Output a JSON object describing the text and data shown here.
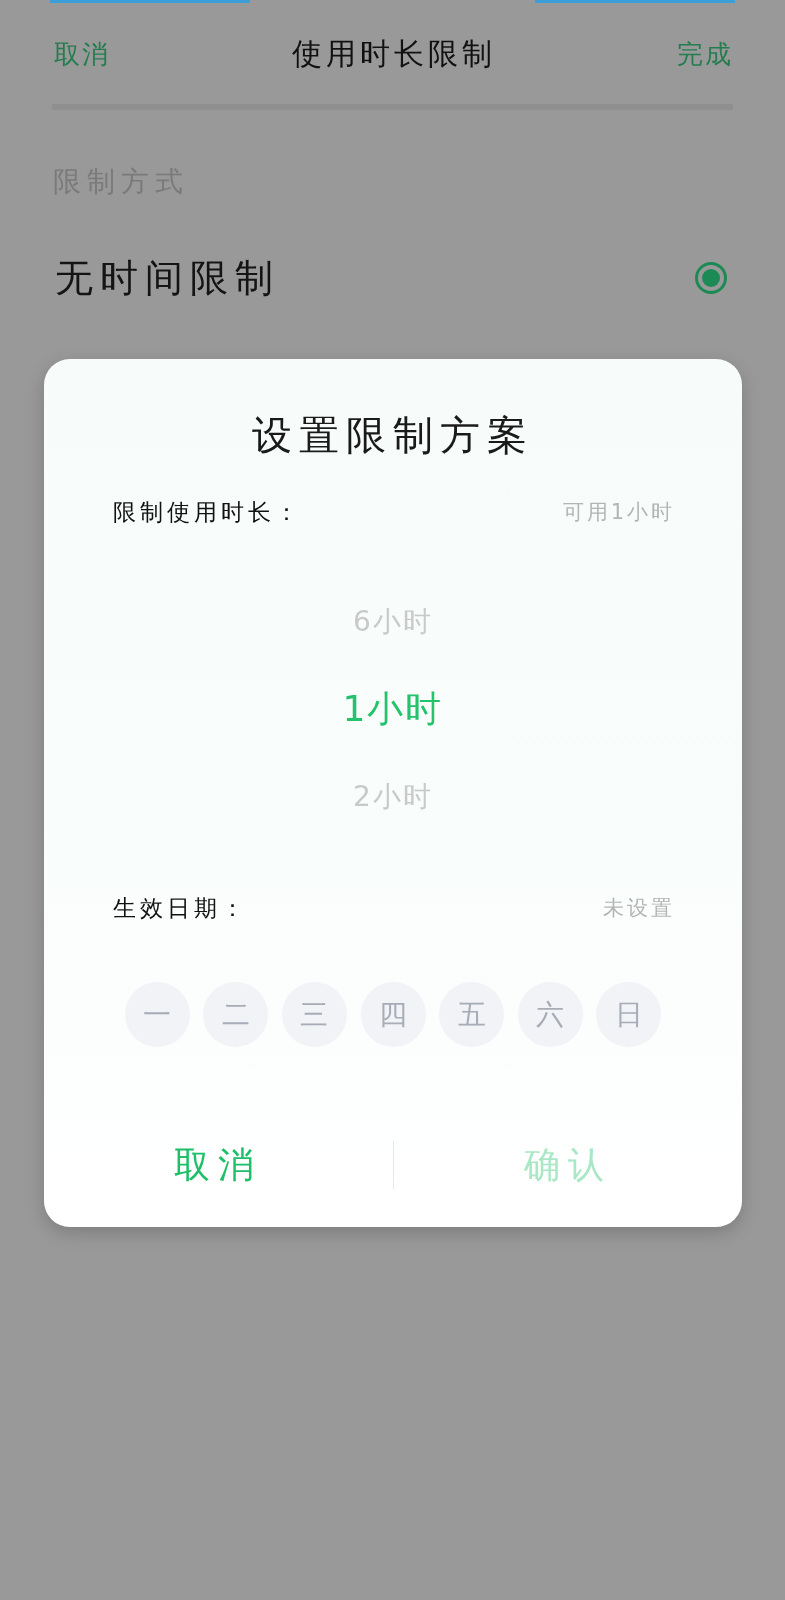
{
  "header": {
    "cancel": "取消",
    "title": "使用时长限制",
    "done": "完成"
  },
  "section_label": "限制方式",
  "options": [
    {
      "label": "无时间限制",
      "selected": true
    }
  ],
  "dialog": {
    "title": "设置限制方案",
    "duration": {
      "label": "限制使用时长：",
      "value": "可用1小时",
      "picker": [
        {
          "label": "6小时",
          "selected": false
        },
        {
          "label": "1小时",
          "selected": true
        },
        {
          "label": "2小时",
          "selected": false
        }
      ]
    },
    "effective_date": {
      "label": "生效日期：",
      "value": "未设置",
      "days": [
        {
          "label": "一",
          "selected": false
        },
        {
          "label": "二",
          "selected": false
        },
        {
          "label": "三",
          "selected": false
        },
        {
          "label": "四",
          "selected": false
        },
        {
          "label": "五",
          "selected": false
        },
        {
          "label": "六",
          "selected": false
        },
        {
          "label": "日",
          "selected": false
        }
      ]
    },
    "buttons": [
      {
        "label": "取消",
        "disabled": false
      },
      {
        "label": "确认",
        "disabled": true
      }
    ]
  }
}
